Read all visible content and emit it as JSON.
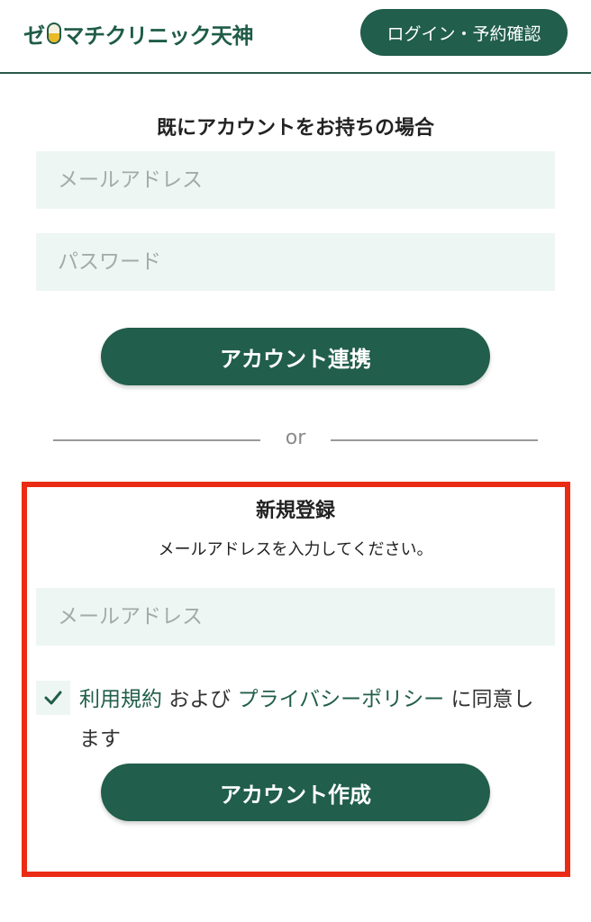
{
  "header": {
    "logo_pre": "ゼ",
    "logo_post": "マチクリニック天神",
    "login_button": "ログイン・予約確認"
  },
  "existing": {
    "title": "既にアカウントをお持ちの場合",
    "email_placeholder": "メールアドレス",
    "password_placeholder": "パスワード",
    "link_button": "アカウント連携"
  },
  "divider": {
    "text": "or"
  },
  "signup": {
    "title": "新規登録",
    "instruction": "メールアドレスを入力してください。",
    "email_placeholder": "メールアドレス",
    "consent_checked": true,
    "terms_link": "利用規約",
    "and_text": " および ",
    "privacy_link": "プライバシーポリシー",
    "consent_tail": " に同意します",
    "create_button": "アカウント作成"
  },
  "colors": {
    "brand": "#215e4b",
    "field_bg": "#eef6f3",
    "highlight": "#ea2c14"
  },
  "icons": {
    "checkbox": "check-icon"
  }
}
